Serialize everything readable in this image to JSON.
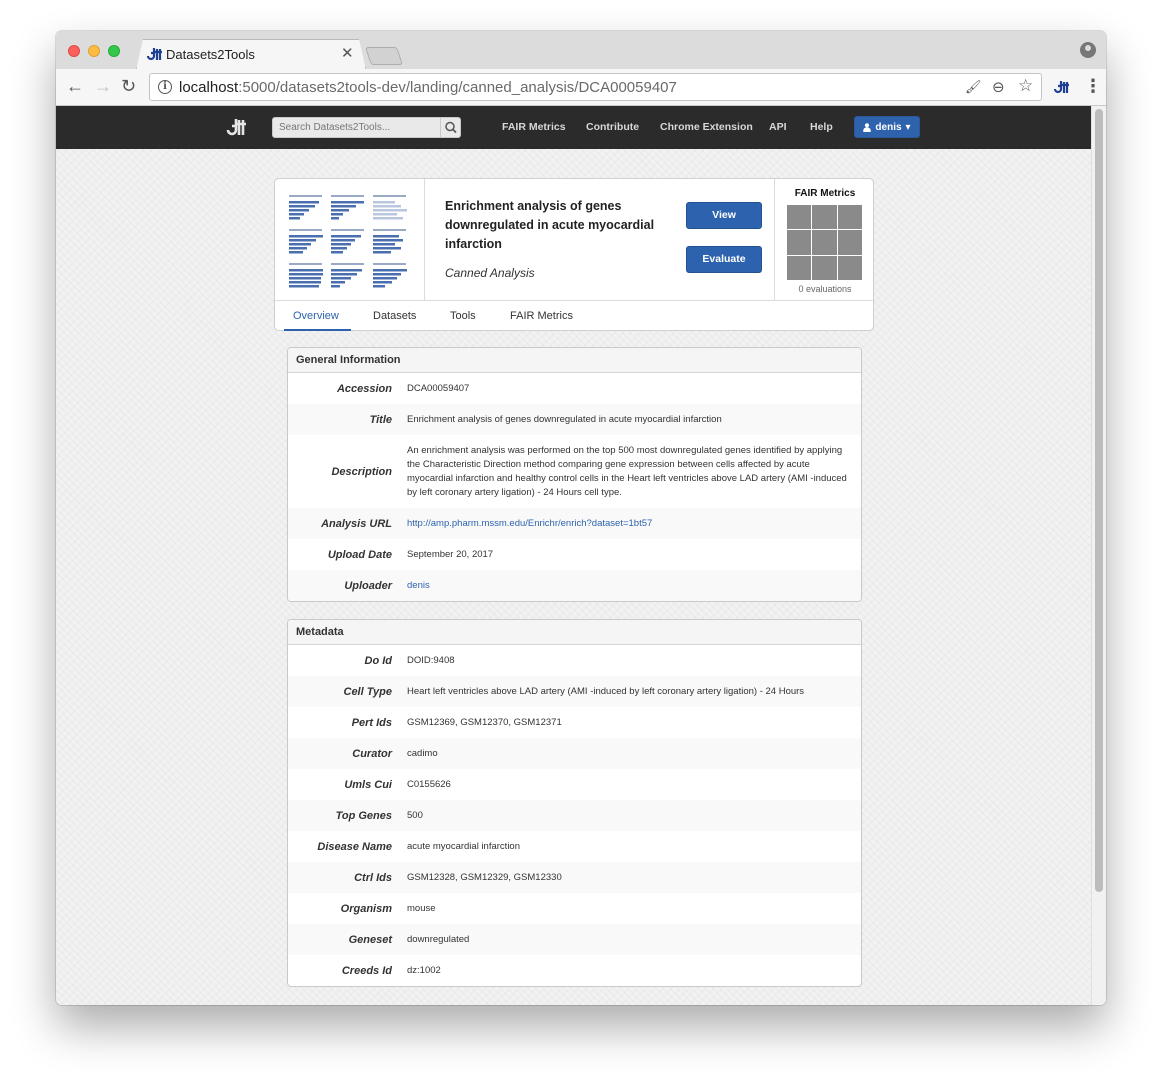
{
  "browser": {
    "tab_title": "Datasets2Tools",
    "close_glyph": "✕",
    "url_host": "localhost",
    "url_path": ":5000/datasets2tools-dev/landing/canned_analysis/DCA00059407",
    "info_glyph": "i",
    "back_glyph": "←",
    "forward_glyph": "→",
    "reload_glyph": "↻",
    "paint_glyph": "🖌",
    "zoom_glyph": "⊖",
    "star_glyph": "☆",
    "menu_glyph": "⋮"
  },
  "site_nav": {
    "search_placeholder": "Search Datasets2Tools...",
    "links": [
      "FAIR Metrics",
      "Contribute",
      "Chrome Extension",
      "API",
      "Help"
    ],
    "user_label": "denis",
    "user_icon": "user-icon",
    "caret": "▾"
  },
  "header": {
    "title": "Enrichment analysis of genes downregulated in acute myocardial infarction",
    "subtitle": "Canned Analysis",
    "view_label": "View",
    "evaluate_label": "Evaluate",
    "fair_title": "FAIR Metrics",
    "fair_count": "0 evaluations",
    "tabs": [
      "Overview",
      "Datasets",
      "Tools",
      "FAIR Metrics"
    ]
  },
  "general": {
    "heading": "General Information",
    "rows": [
      {
        "key": "Accession",
        "value": "DCA00059407"
      },
      {
        "key": "Title",
        "value": "Enrichment analysis of genes downregulated in acute myocardial infarction"
      },
      {
        "key": "Description",
        "value": "An enrichment analysis was performed on the top 500 most downregulated genes identified by applying the Characteristic Direction method comparing gene expression between cells affected by acute myocardial infarction and healthy control cells in the Heart left ventricles above LAD artery (AMI -induced by left coronary artery ligation) - 24 Hours cell type."
      },
      {
        "key": "Analysis URL",
        "value": "http://amp.pharm.mssm.edu/Enrichr/enrich?dataset=1bt57"
      },
      {
        "key": "Upload Date",
        "value": "September 20, 2017"
      },
      {
        "key": "Uploader",
        "value": "denis"
      }
    ]
  },
  "metadata": {
    "heading": "Metadata",
    "rows": [
      {
        "key": "Do Id",
        "value": "DOID:9408"
      },
      {
        "key": "Cell Type",
        "value": "Heart left ventricles above LAD artery (AMI -induced by left coronary artery ligation) - 24 Hours"
      },
      {
        "key": "Pert Ids",
        "value": "GSM12369, GSM12370, GSM12371"
      },
      {
        "key": "Curator",
        "value": "cadimo"
      },
      {
        "key": "Umls Cui",
        "value": "C0155626"
      },
      {
        "key": "Top Genes",
        "value": "500"
      },
      {
        "key": "Disease Name",
        "value": "acute myocardial infarction"
      },
      {
        "key": "Ctrl Ids",
        "value": "GSM12328, GSM12329, GSM12330"
      },
      {
        "key": "Organism",
        "value": "mouse"
      },
      {
        "key": "Geneset",
        "value": "downregulated"
      },
      {
        "key": "Creeds Id",
        "value": "dz:1002"
      }
    ]
  },
  "colors": {
    "accent": "#2d63ae",
    "navbar": "#2b2b2b",
    "fair_cell": "#8a8a8a"
  }
}
